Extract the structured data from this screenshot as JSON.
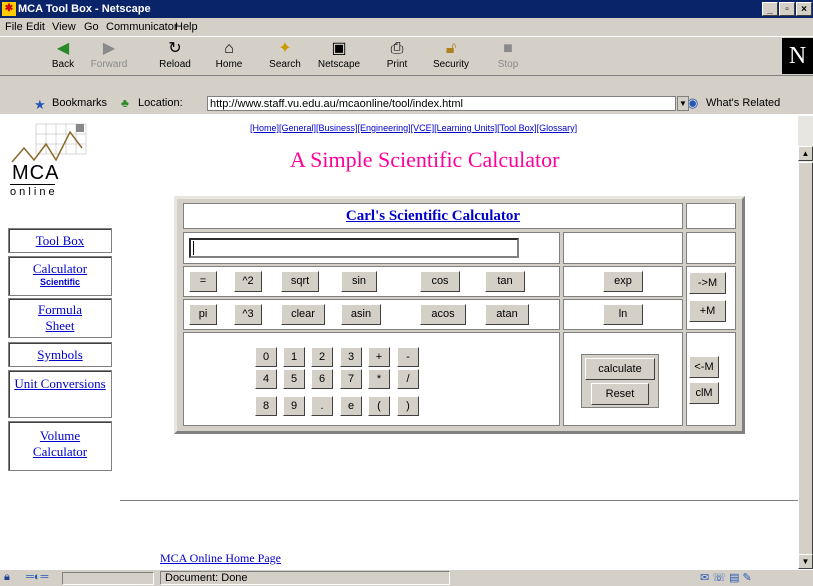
{
  "window": {
    "title": "MCA Tool Box - Netscape"
  },
  "menu": [
    "File",
    "Edit",
    "View",
    "Go",
    "Communicator",
    "Help"
  ],
  "toolbar": [
    {
      "label": "Back",
      "icon": "back-arrow-icon",
      "enabled": true
    },
    {
      "label": "Forward",
      "icon": "forward-arrow-icon",
      "enabled": false
    },
    {
      "label": "Reload",
      "icon": "reload-icon",
      "enabled": true
    },
    {
      "label": "Home",
      "icon": "home-icon",
      "enabled": true
    },
    {
      "label": "Search",
      "icon": "search-icon",
      "enabled": true
    },
    {
      "label": "Netscape",
      "icon": "netscape-icon",
      "enabled": true
    },
    {
      "label": "Print",
      "icon": "print-icon",
      "enabled": true
    },
    {
      "label": "Security",
      "icon": "lock-icon",
      "enabled": true
    },
    {
      "label": "Stop",
      "icon": "stop-icon",
      "enabled": false
    }
  ],
  "location": {
    "bookmarks_label": "Bookmarks",
    "location_label": "Location:",
    "url": "http://www.staff.vu.edu.au/mcaonline/tool/index.html",
    "whats_related": "What's Related"
  },
  "logo": {
    "text": "MCA",
    "subtext": "o n l i n e"
  },
  "sidebar": [
    {
      "label": "Tool Box",
      "sub": ""
    },
    {
      "label": "Calculator",
      "sub": "Scientific"
    },
    {
      "label": "Formula Sheet",
      "sub": ""
    },
    {
      "label": "Symbols",
      "sub": ""
    },
    {
      "label": "Unit Conversions",
      "sub": ""
    },
    {
      "label": "Volume Calculator",
      "sub": ""
    }
  ],
  "topnav": "[Home][General][Business][Engineering][VCE][Learning Units][Tool Box][Glossary]",
  "page_title": "A Simple Scientific Calculator",
  "calculator": {
    "title": "Carl's Scientific Calculator",
    "display_value": "",
    "row1": [
      "=",
      "^2",
      "sqrt",
      "sin",
      "cos",
      "tan",
      "exp"
    ],
    "row2": [
      "pi",
      "^3",
      "clear",
      "asin",
      "acos",
      "atan",
      "ln"
    ],
    "memory_top": [
      "->M",
      "+M"
    ],
    "keypad": [
      [
        "0",
        "1",
        "2",
        "3",
        "+",
        "-"
      ],
      [
        "4",
        "5",
        "6",
        "7",
        "*",
        "/"
      ],
      [
        "8",
        "9",
        ".",
        "e",
        "(",
        ")"
      ]
    ],
    "actions": [
      "calculate",
      "Reset"
    ],
    "memory_bottom": [
      "<-M",
      "clM"
    ]
  },
  "footer_link": "MCA Online Home Page",
  "status": "Document: Done",
  "colors": {
    "title_pink": "#ff0099",
    "link_blue": "#0000cc",
    "chrome": "#d4d0c8"
  }
}
